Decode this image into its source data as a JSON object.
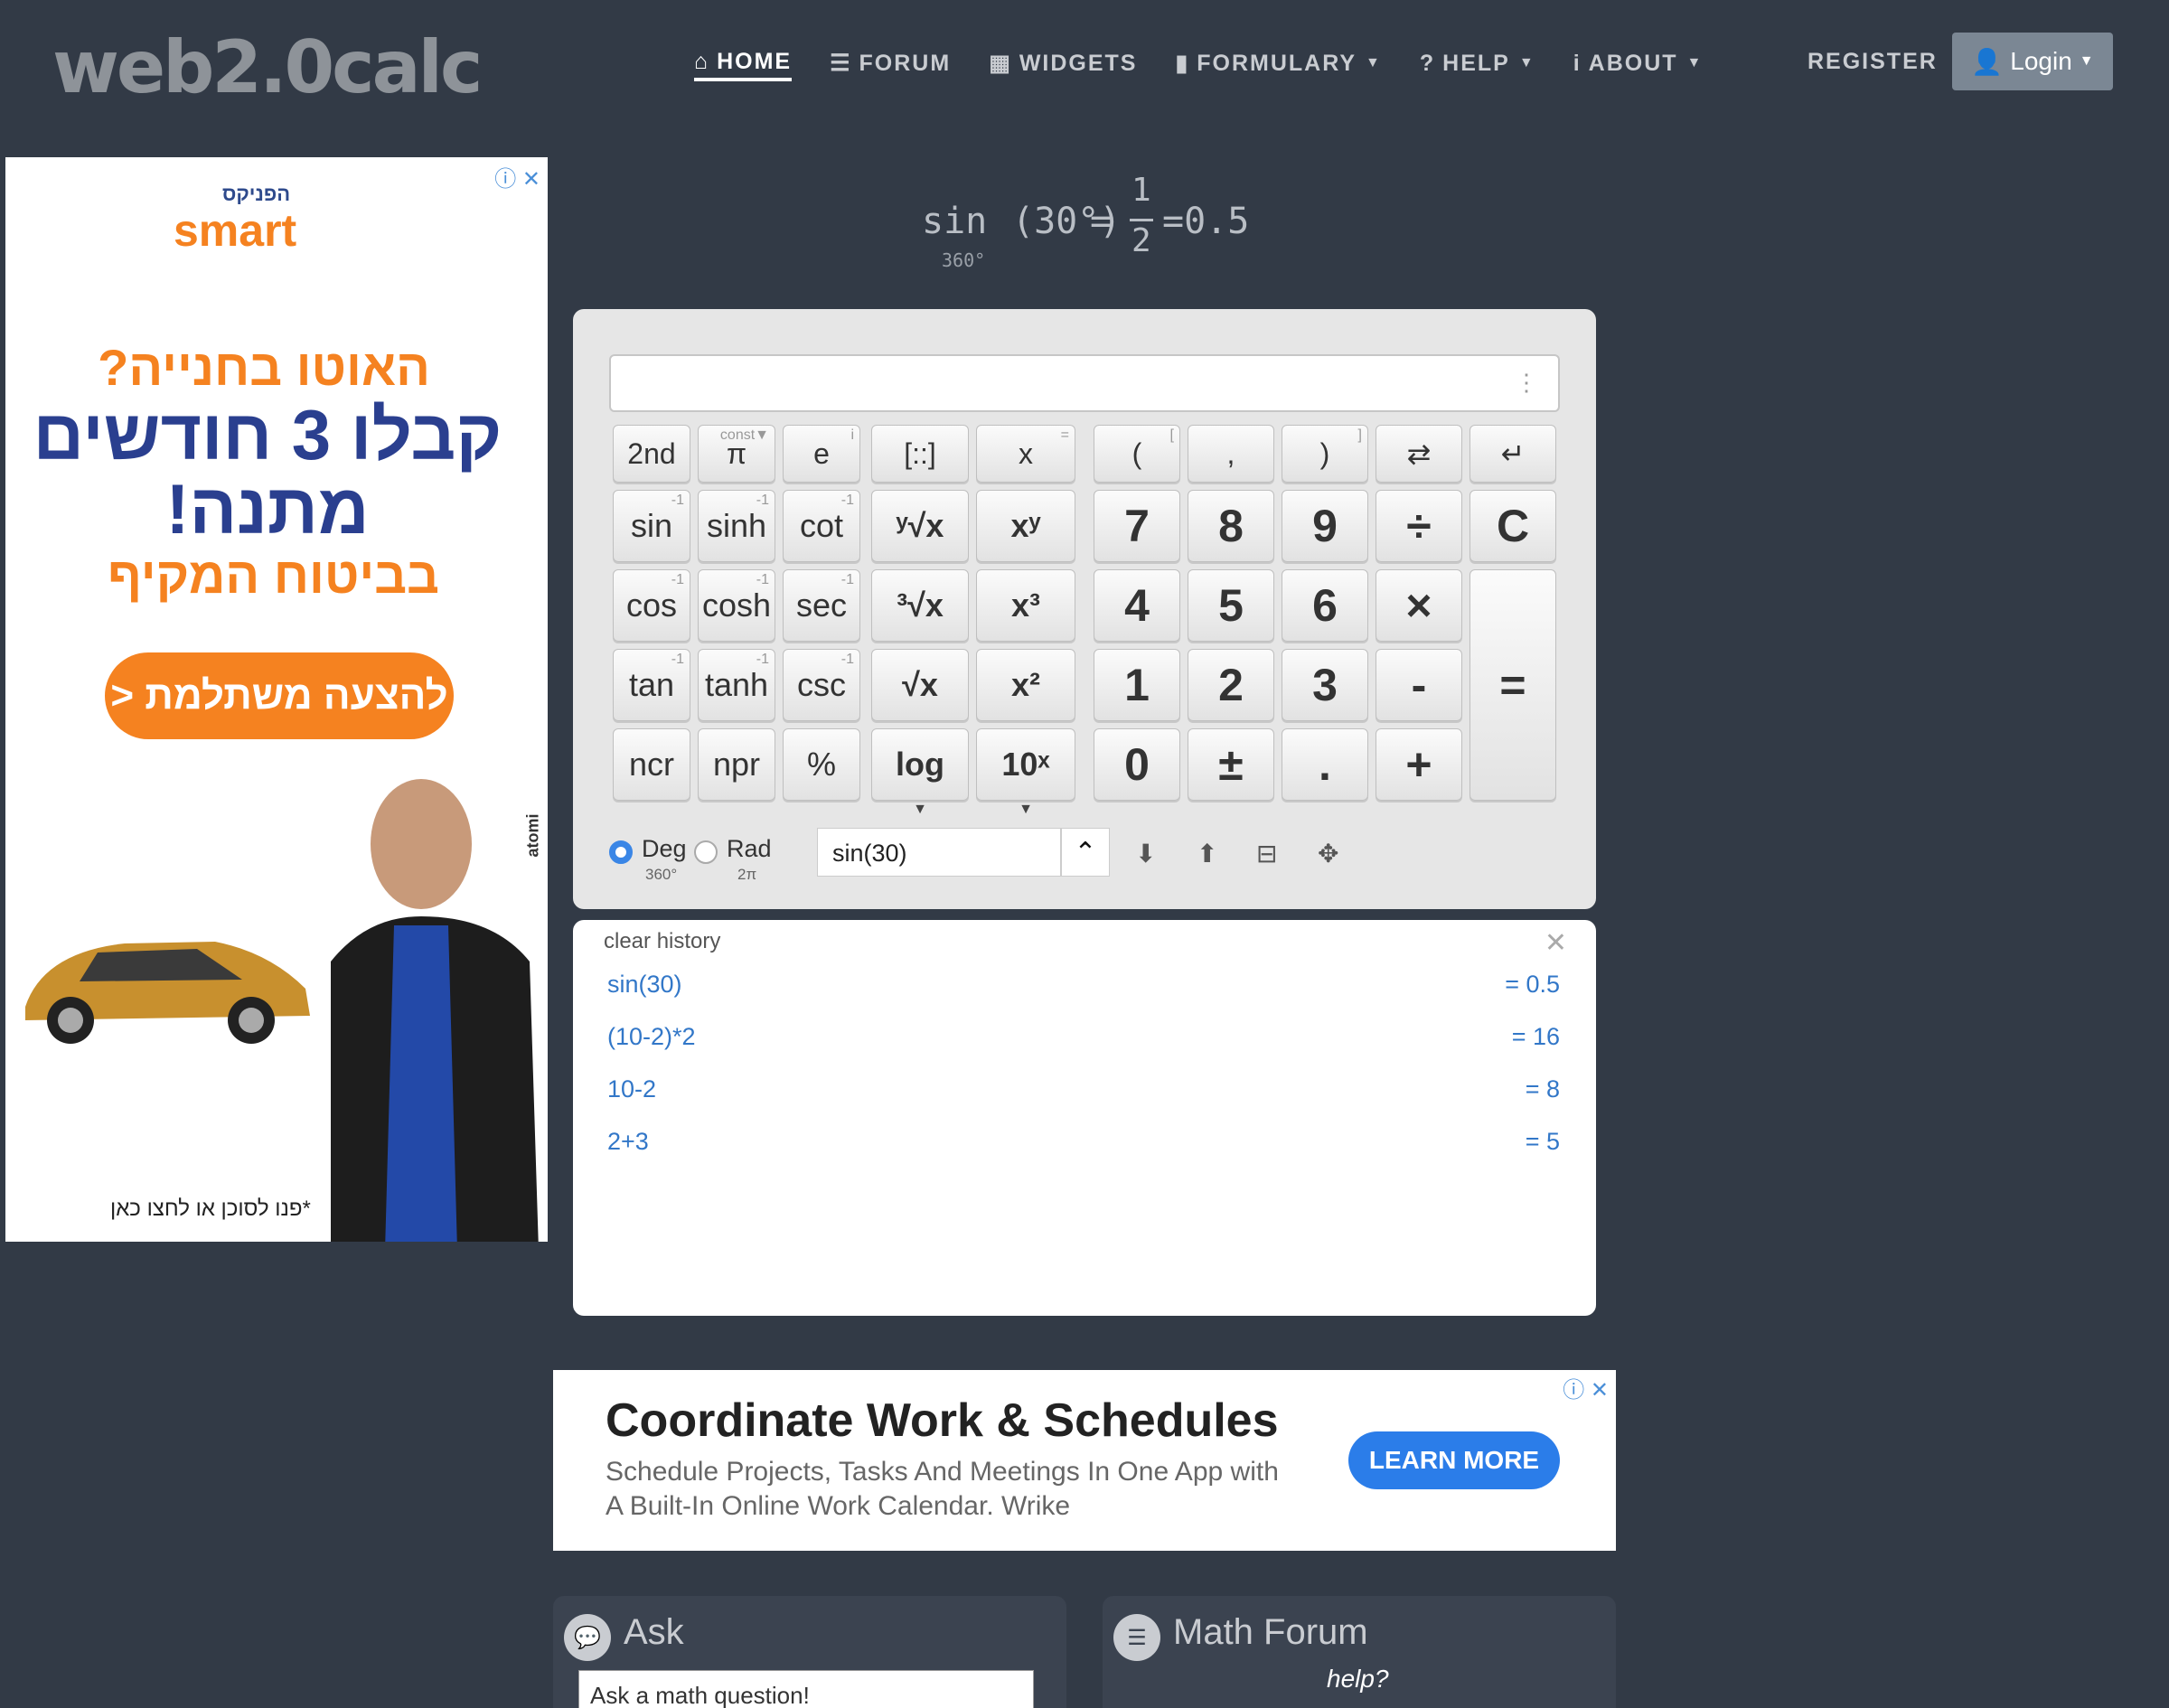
{
  "header": {
    "logo": "web2.0calc",
    "nav": [
      {
        "label": "HOME",
        "icon": "⌂"
      },
      {
        "label": "FORUM",
        "icon": "☰"
      },
      {
        "label": "WIDGETS",
        "icon": "▦"
      },
      {
        "label": "FORMULARY",
        "icon": "▮"
      },
      {
        "label": "HELP",
        "icon": "?"
      },
      {
        "label": "ABOUT",
        "icon": "i"
      }
    ],
    "register": "REGISTER",
    "login": "Login"
  },
  "ad_left": {
    "brand": "smart",
    "brand_small": "הפניקס",
    "line1": "האוטו בחנייה?",
    "line2": "קבלו 3 חודשים מתנה!",
    "line3": "בביטוח המקיף",
    "cta": "להצעה משתלמת <",
    "fine": "*פנו לסוכן או לחצו כאן",
    "side": "atomi"
  },
  "result": {
    "fn": "sin",
    "arg": "(30°)",
    "eq": "=",
    "numerator": "1",
    "denominator": "2",
    "value": "=0.5",
    "sub": "360°"
  },
  "keys": {
    "r0": [
      "2nd",
      "π",
      "e",
      "[::]",
      "x",
      "(",
      ",",
      ")",
      "⇄",
      "↵"
    ],
    "r0_tags": [
      "",
      "const▼",
      "i",
      "",
      "=",
      "[",
      "",
      "]",
      "",
      ""
    ],
    "trig1": [
      "sin",
      "sinh",
      "cot"
    ],
    "trig2": [
      "cos",
      "cosh",
      "sec"
    ],
    "trig3": [
      "tan",
      "tanh",
      "csc"
    ],
    "trig_tag": "-1",
    "row4": [
      "ncr",
      "npr",
      "%"
    ],
    "pow": [
      "ʸ√x",
      "xʸ",
      "³√x",
      "x³",
      "√x",
      "x²",
      "log",
      "10ˣ"
    ],
    "digits": [
      "7",
      "8",
      "9",
      "4",
      "5",
      "6",
      "1",
      "2",
      "3",
      "0",
      "±",
      "."
    ],
    "ops": [
      "÷",
      "×",
      "-",
      "+"
    ],
    "clear": "C",
    "equals": "="
  },
  "mode": {
    "deg": "Deg",
    "deg_sub": "360°",
    "rad": "Rad",
    "rad_sub": "2π",
    "input": "sin(30)",
    "toggle": "⌃"
  },
  "history": {
    "clear": "clear history",
    "rows": [
      {
        "expr": "sin(30)",
        "val": "= 0.5"
      },
      {
        "expr": "(10-2)*2",
        "val": "= 16"
      },
      {
        "expr": "10-2",
        "val": "= 8"
      },
      {
        "expr": "2+3",
        "val": "= 5"
      }
    ]
  },
  "ad_bottom": {
    "title": "Coordinate Work & Schedules",
    "desc": "Schedule Projects, Tasks And Meetings In One App with A Built-In Online Work Calendar. Wrike",
    "button": "LEARN MORE"
  },
  "widgets": {
    "ask_title": "Ask",
    "ask_placeholder": "Ask a math question!",
    "forum_title": "Math Forum",
    "forum_help": "help?"
  }
}
